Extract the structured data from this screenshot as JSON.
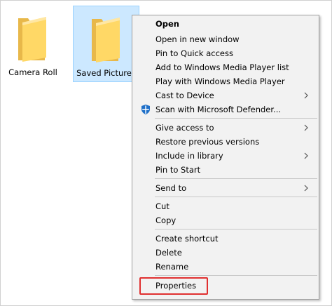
{
  "folders": [
    {
      "name": "Camera Roll"
    },
    {
      "name": "Saved Pictures"
    }
  ],
  "context_menu": {
    "items": {
      "open": "Open",
      "open_new_window": "Open in new window",
      "pin_quick_access": "Pin to Quick access",
      "add_wmp_list": "Add to Windows Media Player list",
      "play_wmp": "Play with Windows Media Player",
      "cast_to_device": "Cast to Device",
      "scan_defender": "Scan with Microsoft Defender...",
      "give_access": "Give access to",
      "restore_versions": "Restore previous versions",
      "include_library": "Include in library",
      "pin_start": "Pin to Start",
      "send_to": "Send to",
      "cut": "Cut",
      "copy": "Copy",
      "create_shortcut": "Create shortcut",
      "delete": "Delete",
      "rename": "Rename",
      "properties": "Properties"
    },
    "highlight_color": "#e03030"
  },
  "colors": {
    "selection_bg": "#cce8ff",
    "selection_border": "#99d1ff",
    "menu_bg": "#f2f2f2",
    "folder_yellow": "#ffd866"
  },
  "icons": {
    "folder": "folder-icon",
    "defender": "defender-shield-icon",
    "submenu": "chevron-right-icon"
  }
}
